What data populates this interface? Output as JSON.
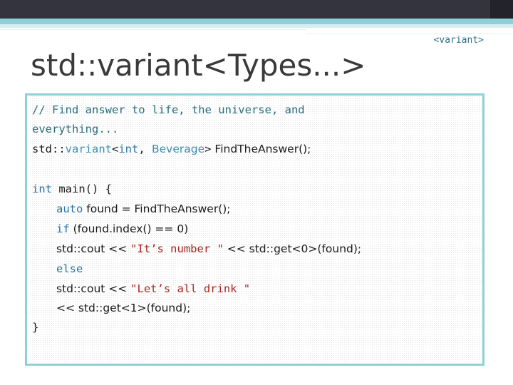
{
  "header": {
    "tag": "<variant>"
  },
  "slide": {
    "title": "std::variant<Types...>"
  },
  "code": {
    "comment_1": "// Find answer to life, the universe, and",
    "comment_2": "everything...",
    "decl_std": "std::",
    "decl_variant": "variant",
    "decl_lt": "<",
    "decl_int": "int",
    "decl_comma": ", ",
    "decl_beverage": "Beverage",
    "decl_gt": ">",
    "decl_rest": " FindTheAnswer();",
    "main_kw": "int",
    "main_rest": " main() {",
    "auto_kw": "auto",
    "auto_rest": " found = FindTheAnswer();",
    "if_kw": "if",
    "if_rest": " (found.index() == 0)",
    "cout1_pre": "std::cout << ",
    "cout1_str": "\"It’s number \"",
    "cout1_post": " << std::get<0>(found);",
    "else_kw": "else",
    "cout2_pre": "std::cout << ",
    "cout2_str": "\"Let’s all drink \"",
    "cont": "<< std::get<1>(found);",
    "close": "}"
  }
}
